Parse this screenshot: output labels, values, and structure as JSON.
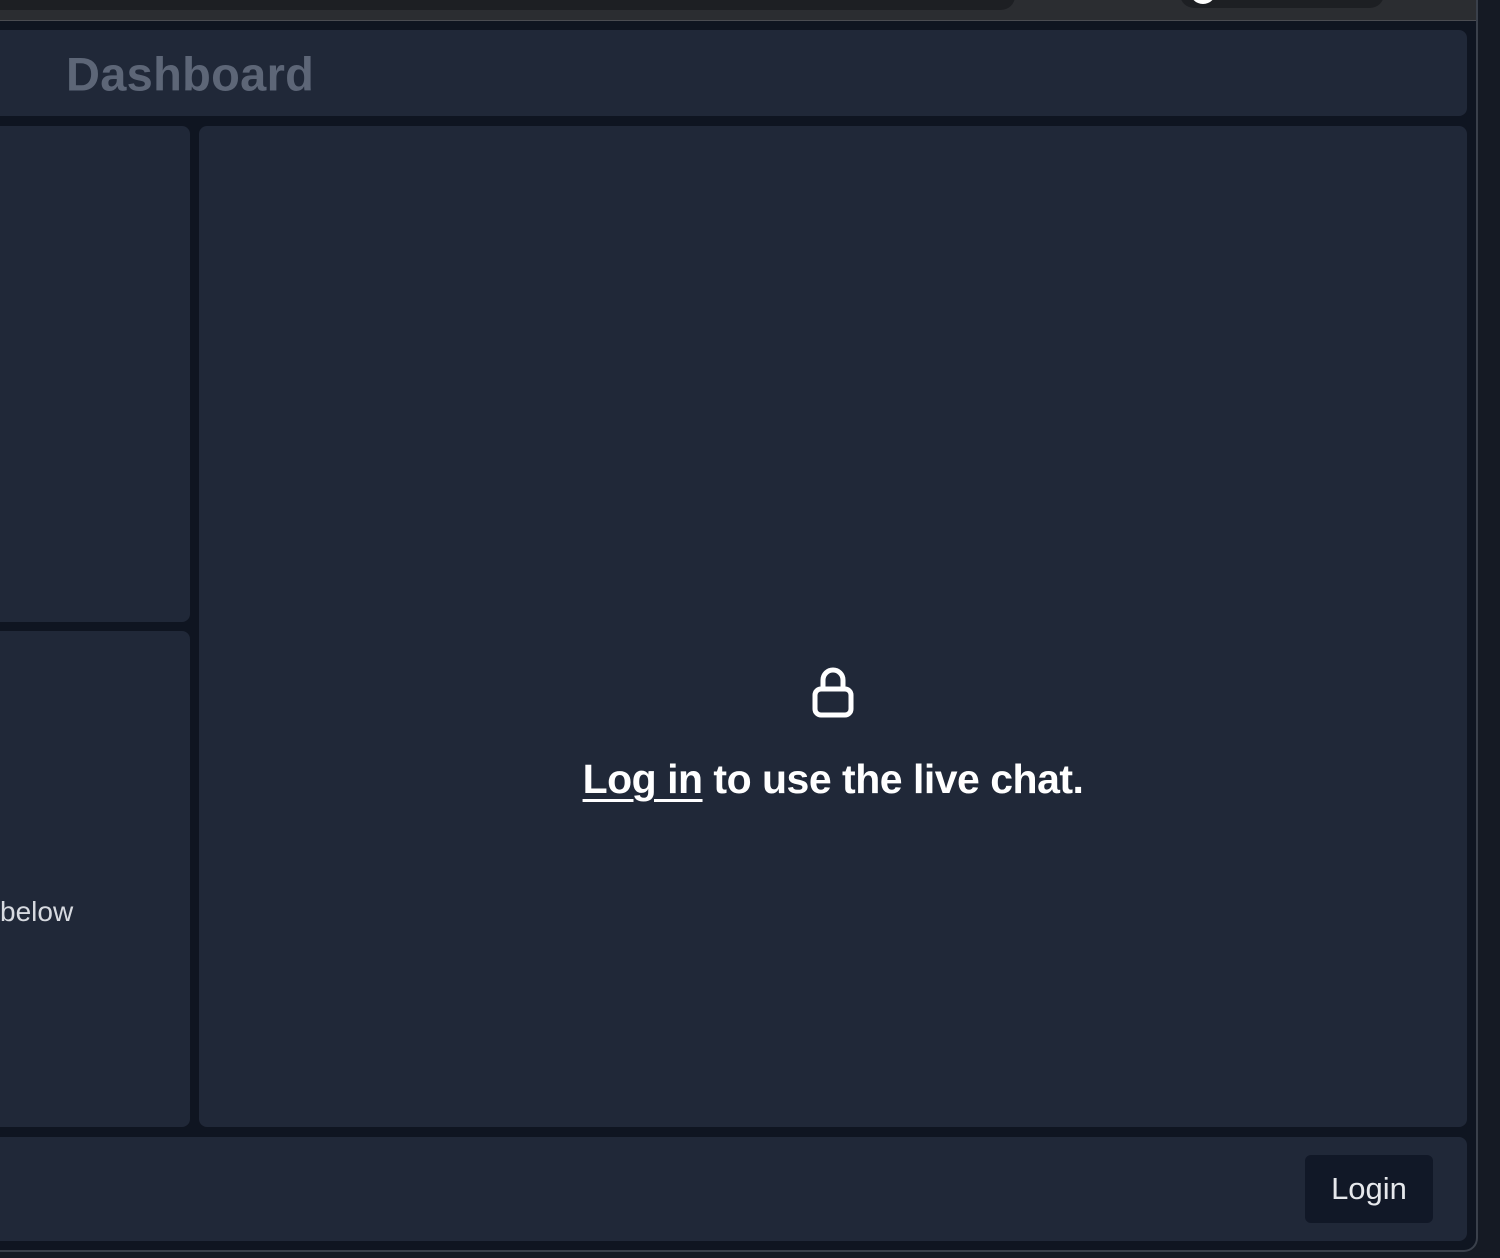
{
  "header": {
    "title": "Dashboard"
  },
  "left_panel": {
    "note": "below"
  },
  "chat": {
    "lock_icon": "lock-icon",
    "login_link": "Log in",
    "message_rest": " to use the live chat."
  },
  "footer": {
    "login_label": "Login"
  },
  "colors": {
    "background": "#0f1521",
    "panel": "#202838",
    "button": "#111827",
    "title": "#5d6677",
    "text": "#ffffff"
  }
}
